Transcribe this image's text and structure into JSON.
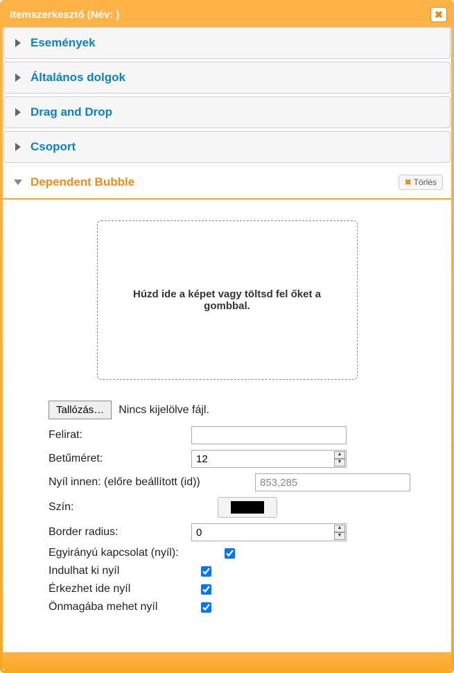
{
  "dialog": {
    "title": "Itemszerkesztő (Név:  )"
  },
  "accordion": {
    "items": [
      {
        "label": "Események"
      },
      {
        "label": "Általános dolgok"
      },
      {
        "label": "Drag and Drop"
      },
      {
        "label": "Csoport"
      }
    ],
    "active": {
      "label": "Dependent Bubble",
      "delete_label": "Törlés"
    }
  },
  "dropzone": {
    "text": "Húzd ide a képet vagy töltsd fel őket a gombbal."
  },
  "file": {
    "browse": "Tallózás…",
    "status": "Nincs kijelölve fájl."
  },
  "form": {
    "felirat": {
      "label": "Felirat:",
      "value": ""
    },
    "betumeret": {
      "label": "Betűméret:",
      "value": "12"
    },
    "nyil_innen": {
      "label": "Nyíl innen: (előre beállított (id))",
      "value": "853,285"
    },
    "szin": {
      "label": "Szín:",
      "value": "#000000"
    },
    "border_radius": {
      "label": "Border radius:",
      "value": "0"
    },
    "egyiranyu": {
      "label": "Egyirányú kapcsolat (nyíl):",
      "checked": true
    },
    "indulhat": {
      "label": "Indulhat ki nyíl",
      "checked": true
    },
    "erkezhet": {
      "label": "Érkezhet ide nyíl",
      "checked": true
    },
    "onmagaba": {
      "label": "Önmagába mehet nyíl",
      "checked": true
    }
  }
}
